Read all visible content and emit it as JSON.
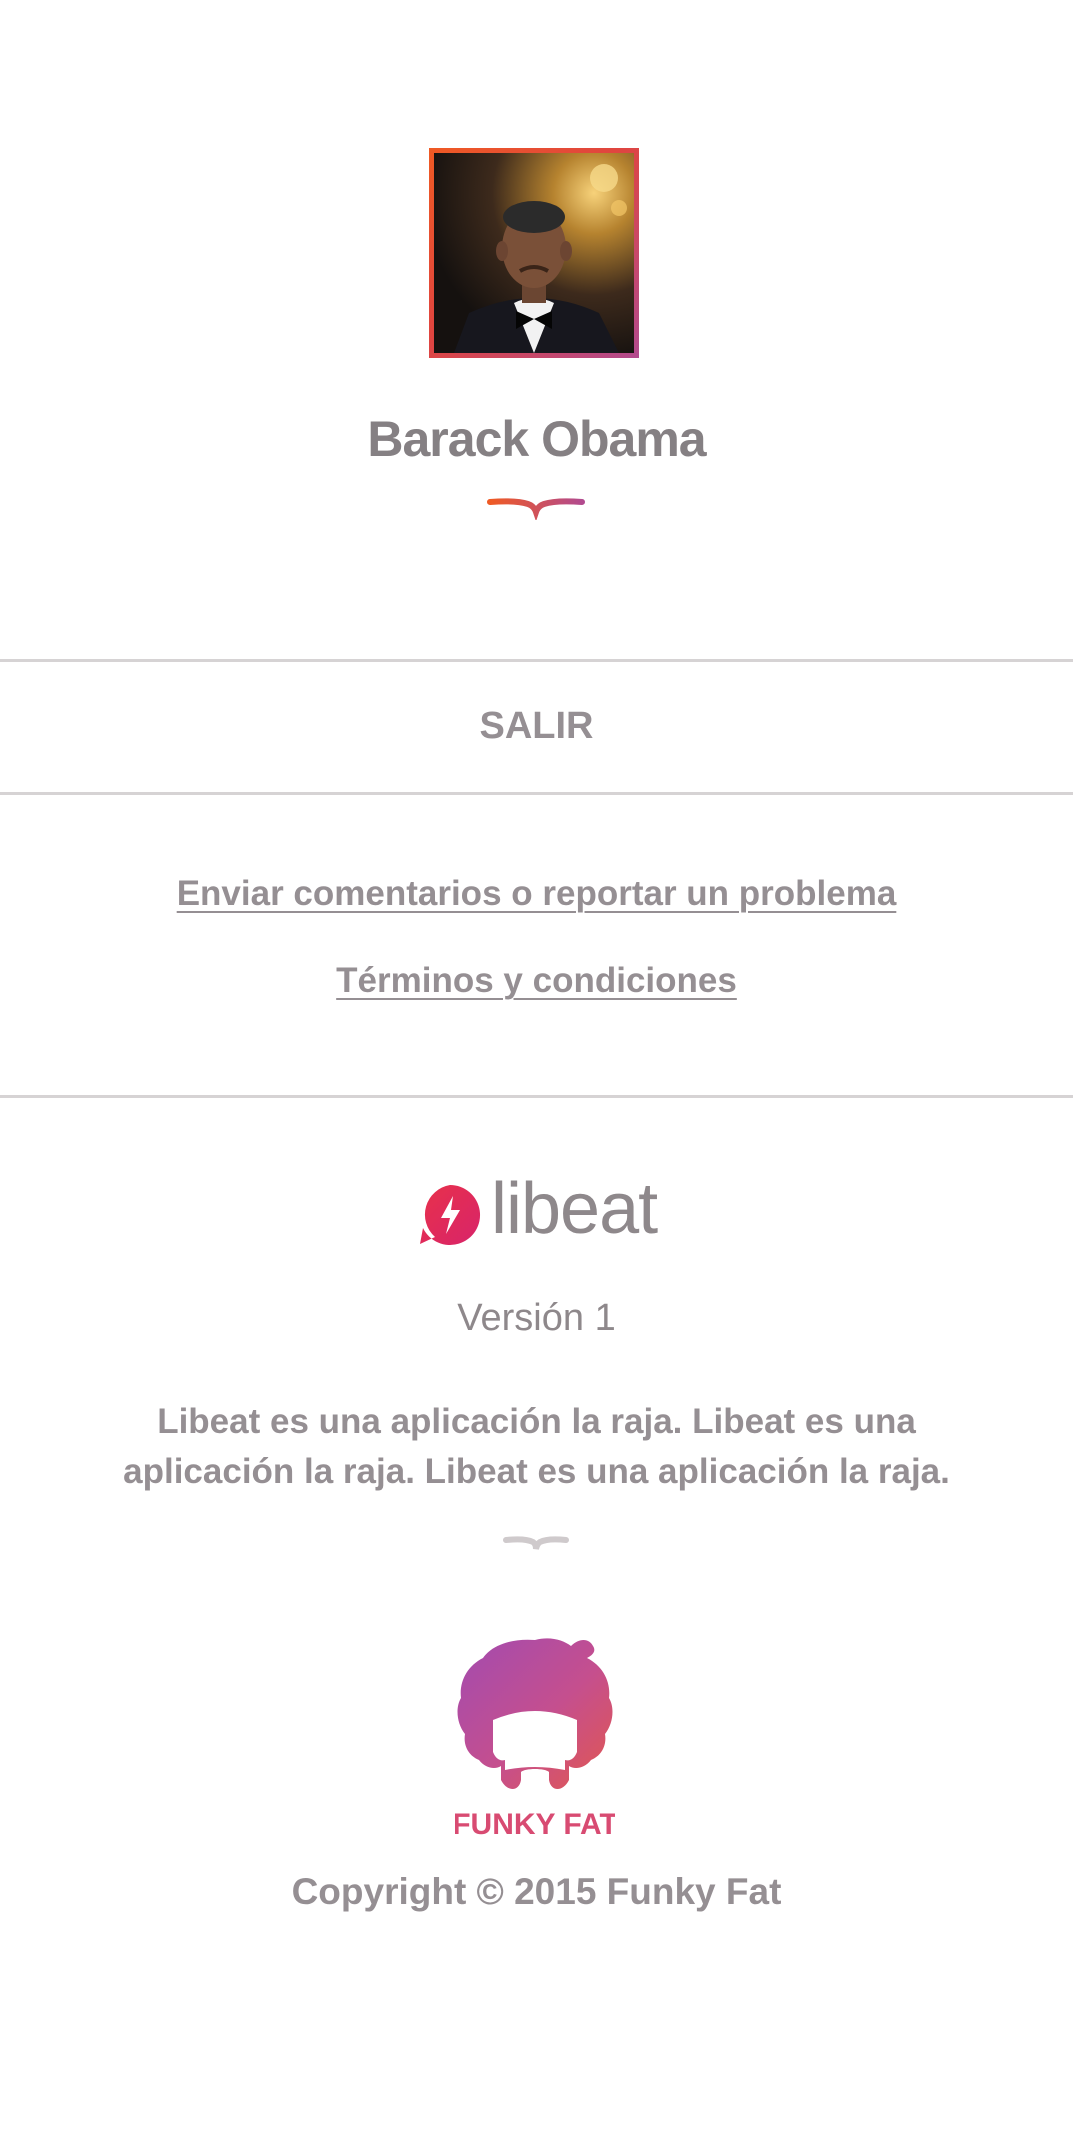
{
  "profile": {
    "name": "Barack Obama",
    "avatar_alt": "profile photo"
  },
  "actions": {
    "logout_label": "SALIR"
  },
  "links": {
    "feedback": "Enviar comentarios o reportar un problema",
    "terms": "Términos y condiciones"
  },
  "app": {
    "logo_text": "libeat",
    "logo_icon": "lightning-bolt-icon",
    "version": "Versión 1",
    "description": "Libeat es una aplicación la raja. Libeat es una aplicación la raja. Libeat es una aplicación la raja."
  },
  "company": {
    "logo_text": "FUNKY FAT",
    "copyright": "Copyright © 2015 Funky Fat"
  },
  "colors": {
    "accent_orange": "#ef5a24",
    "accent_red": "#e0453f",
    "accent_purple": "#b24a8e",
    "text_gray": "#958f93",
    "divider_gray": "#d6d3d4"
  }
}
